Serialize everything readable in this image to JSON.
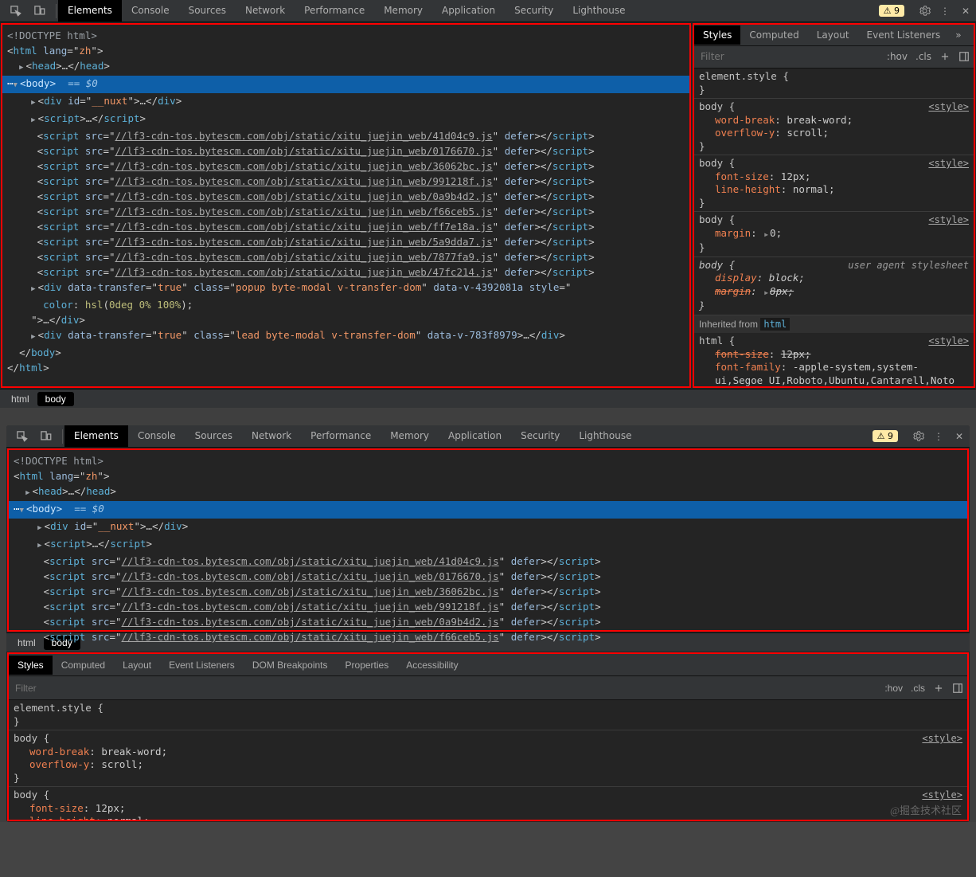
{
  "warning_count": "9",
  "toolbar_tabs": [
    "Elements",
    "Console",
    "Sources",
    "Network",
    "Performance",
    "Memory",
    "Application",
    "Security",
    "Lighthouse"
  ],
  "toolbar_active": "Elements",
  "crumbs": [
    "html",
    "body"
  ],
  "dom": {
    "doctype": "<!DOCTYPE html>",
    "html_open": {
      "tag": "html",
      "attr": "lang",
      "val": "zh"
    },
    "head": {
      "open": "head",
      "ell": "…",
      "close": "head"
    },
    "body_sel": {
      "tag": "body",
      "hint": "== $0"
    },
    "nuxt": {
      "tag": "div",
      "attr": "id",
      "val": "__nuxt",
      "ell": "…"
    },
    "script_inline": {
      "tag": "script",
      "ell": "…"
    },
    "scripts": [
      "//lf3-cdn-tos.bytescm.com/obj/static/xitu_juejin_web/41d04c9.js",
      "//lf3-cdn-tos.bytescm.com/obj/static/xitu_juejin_web/0176670.js",
      "//lf3-cdn-tos.bytescm.com/obj/static/xitu_juejin_web/36062bc.js",
      "//lf3-cdn-tos.bytescm.com/obj/static/xitu_juejin_web/991218f.js",
      "//lf3-cdn-tos.bytescm.com/obj/static/xitu_juejin_web/0a9b4d2.js",
      "//lf3-cdn-tos.bytescm.com/obj/static/xitu_juejin_web/f66ceb5.js",
      "//lf3-cdn-tos.bytescm.com/obj/static/xitu_juejin_web/ff7e18a.js",
      "//lf3-cdn-tos.bytescm.com/obj/static/xitu_juejin_web/5a9dda7.js",
      "//lf3-cdn-tos.bytescm.com/obj/static/xitu_juejin_web/7877fa9.js",
      "//lf3-cdn-tos.bytescm.com/obj/static/xitu_juejin_web/47fc214.js"
    ],
    "defer": "defer",
    "popup": {
      "tag": "div",
      "a1": "data-transfer",
      "v1": "true",
      "a2": "class",
      "v2": "popup byte-modal v-transfer-dom",
      "a3": "data-v-4392081a",
      "a4": "style",
      "style_line": "color: hsl(0deg 0% 100%);"
    },
    "lead": {
      "tag": "div",
      "a1": "data-transfer",
      "v1": "true",
      "a2": "class",
      "v2": "lead byte-modal v-transfer-dom",
      "a3": "data-v-783f8979",
      "ell": "…"
    },
    "body_close": "body",
    "html_close": "html"
  },
  "styles": {
    "tabs": [
      "Styles",
      "Computed",
      "Layout",
      "Event Listeners"
    ],
    "tabs2": [
      "Styles",
      "Computed",
      "Layout",
      "Event Listeners",
      "DOM Breakpoints",
      "Properties",
      "Accessibility"
    ],
    "filter_ph": "Filter",
    "hov": ":hov",
    "cls": ".cls",
    "link": "<style>",
    "elstyle": "element.style {",
    "rbrace": "}",
    "rules": [
      {
        "sel": "body {",
        "props": [
          {
            "n": "word-break",
            "v": "break-word;"
          },
          {
            "n": "overflow-y",
            "v": "scroll;"
          }
        ]
      },
      {
        "sel": "body {",
        "props": [
          {
            "n": "font-size",
            "v": "12px;"
          },
          {
            "n": "line-height",
            "v": "normal;"
          }
        ]
      },
      {
        "sel": "body {",
        "props": [
          {
            "n": "margin",
            "v": "0;",
            "tri": true
          }
        ]
      },
      {
        "sel": "body {",
        "ua": true,
        "ua_label": "user agent stylesheet",
        "props": [
          {
            "n": "display",
            "v": "block;",
            "ital": true
          },
          {
            "n": "margin",
            "v": "8px;",
            "strike": true,
            "tri": true,
            "ital": true
          }
        ]
      }
    ],
    "inh_label": "Inherited from ",
    "inh_tag": "html",
    "html_rule": {
      "sel": "html {",
      "props": [
        {
          "n": "font-size",
          "v": "12px;",
          "strike": true
        },
        {
          "n": "font-family",
          "v": "-apple-system,system-ui,Segoe UI,Roboto,Ubuntu,Cantarell,Noto Sans,sans-"
        }
      ]
    }
  },
  "watermark": "@掘金技术社区"
}
